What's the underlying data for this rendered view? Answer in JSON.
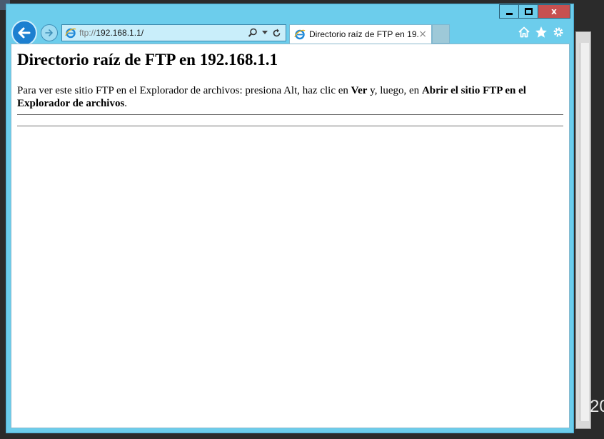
{
  "window": {
    "buttons": {
      "minimize": "minimize",
      "maximize": "maximize",
      "close": "x"
    }
  },
  "navigation": {
    "address_scheme": "ftp://",
    "address_host": "192.168.1.1/"
  },
  "tab": {
    "title": "Directorio raíz de FTP en 19...",
    "close": "×"
  },
  "page": {
    "heading": "Directorio raíz de FTP en 192.168.1.1",
    "instruction_prefix": "Para ver este sitio FTP en el Explorador de archivos: presiona Alt, haz clic en ",
    "instruction_view": "Ver",
    "instruction_middle": " y, luego, en ",
    "instruction_open": "Abrir el sitio FTP en el Explorador de archivos",
    "instruction_end": "."
  },
  "desktop": {
    "clock_fragment": "20"
  },
  "colors": {
    "frame": "#6ccdec",
    "close_button": "#c75050",
    "back_button": "#1c7fd0"
  }
}
